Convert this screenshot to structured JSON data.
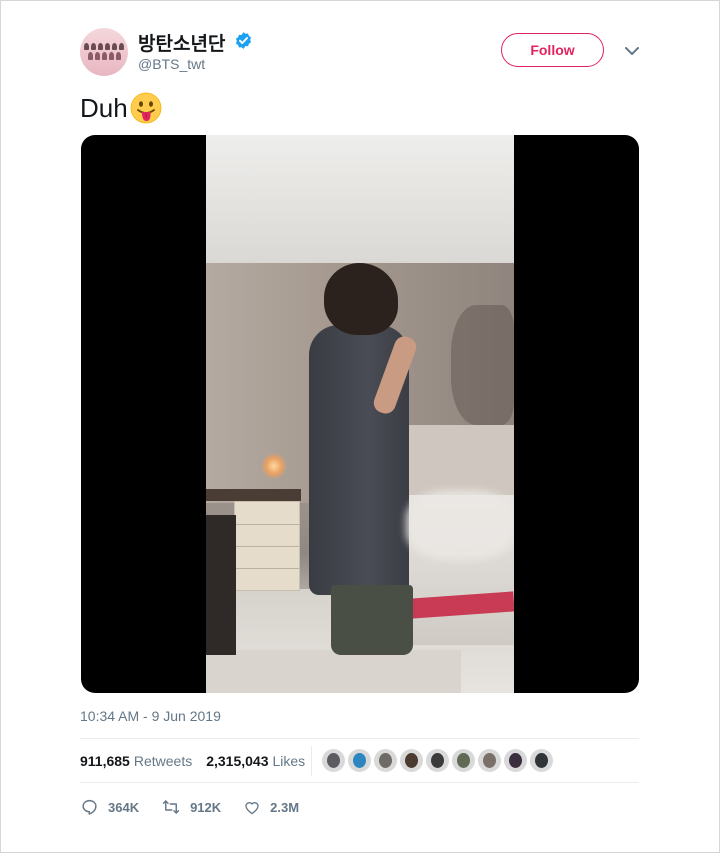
{
  "user": {
    "display_name": "방탄소년단",
    "handle": "@BTS_twt",
    "verified": true
  },
  "follow_button": {
    "label": "Follow"
  },
  "tweet": {
    "text": "Duh",
    "emoji": "face-with-tongue"
  },
  "timestamp": "10:34 AM - 9 Jun 2019",
  "stats": {
    "retweets_count": "911,685",
    "retweets_label": "Retweets",
    "likes_count": "2,315,043",
    "likes_label": "Likes"
  },
  "likers": [
    {
      "color": "#5a5c62"
    },
    {
      "color": "#2e86c1"
    },
    {
      "color": "#6e6a66"
    },
    {
      "color": "#4b3a2f"
    },
    {
      "color": "#3b3b3b"
    },
    {
      "color": "#5f6b55"
    },
    {
      "color": "#7a7069"
    },
    {
      "color": "#3a2e3f"
    },
    {
      "color": "#2f3438"
    }
  ],
  "actions": {
    "reply_count": "364K",
    "retweet_count": "912K",
    "like_count": "2.3M"
  },
  "colors": {
    "follow_accent": "#e0245e",
    "verified_blue": "#1da1f2",
    "muted_text": "#657786"
  }
}
